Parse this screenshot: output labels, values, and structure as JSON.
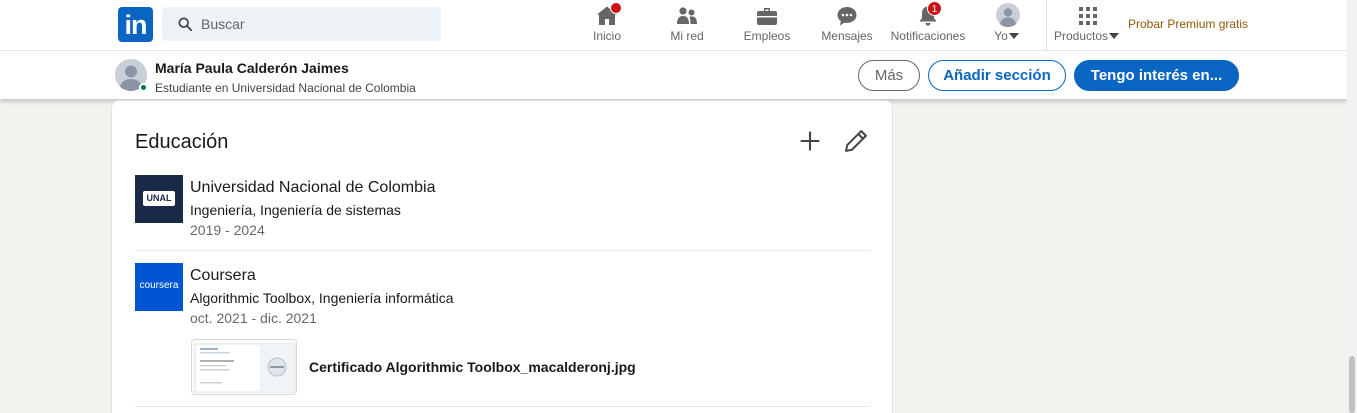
{
  "nav": {
    "logo_text": "in",
    "search_placeholder": "Buscar",
    "items": [
      {
        "label": "Inicio",
        "icon": "home-icon",
        "badge": ""
      },
      {
        "label": "Mi red",
        "icon": "people-icon",
        "badge": ""
      },
      {
        "label": "Empleos",
        "icon": "briefcase-icon",
        "badge": ""
      },
      {
        "label": "Mensajes",
        "icon": "chat-icon",
        "badge": ""
      },
      {
        "label": "Notificaciones",
        "icon": "bell-icon",
        "badge": "1"
      },
      {
        "label": "Yo",
        "icon": "avatar-icon",
        "badge": ""
      },
      {
        "label": "Productos",
        "icon": "grid-icon",
        "badge": ""
      }
    ],
    "premium_link": "Probar Premium gratis",
    "colors": {
      "brand": "#0a66c2",
      "badge": "#cc1016",
      "premium": "#915907"
    }
  },
  "profile_bar": {
    "name": "María Paula Calderón Jaimes",
    "headline": "Estudiante en Universidad Nacional de Colombia",
    "buttons": {
      "more": "Más",
      "add_section": "Añadir sección",
      "interested": "Tengo interés en..."
    }
  },
  "education": {
    "title": "Educación",
    "entries": [
      {
        "logo_text": "UNAL",
        "school": "Universidad Nacional de Colombia",
        "degree": "Ingeniería, Ingeniería de sistemas",
        "dates": "2019 - 2024"
      },
      {
        "logo_text": "coursera",
        "school": "Coursera",
        "degree": "Algorithmic Toolbox, Ingeniería informática",
        "dates": "oct. 2021 - dic. 2021",
        "media_title": "Certificado Algorithmic Toolbox_macalderonj.jpg"
      }
    ]
  }
}
